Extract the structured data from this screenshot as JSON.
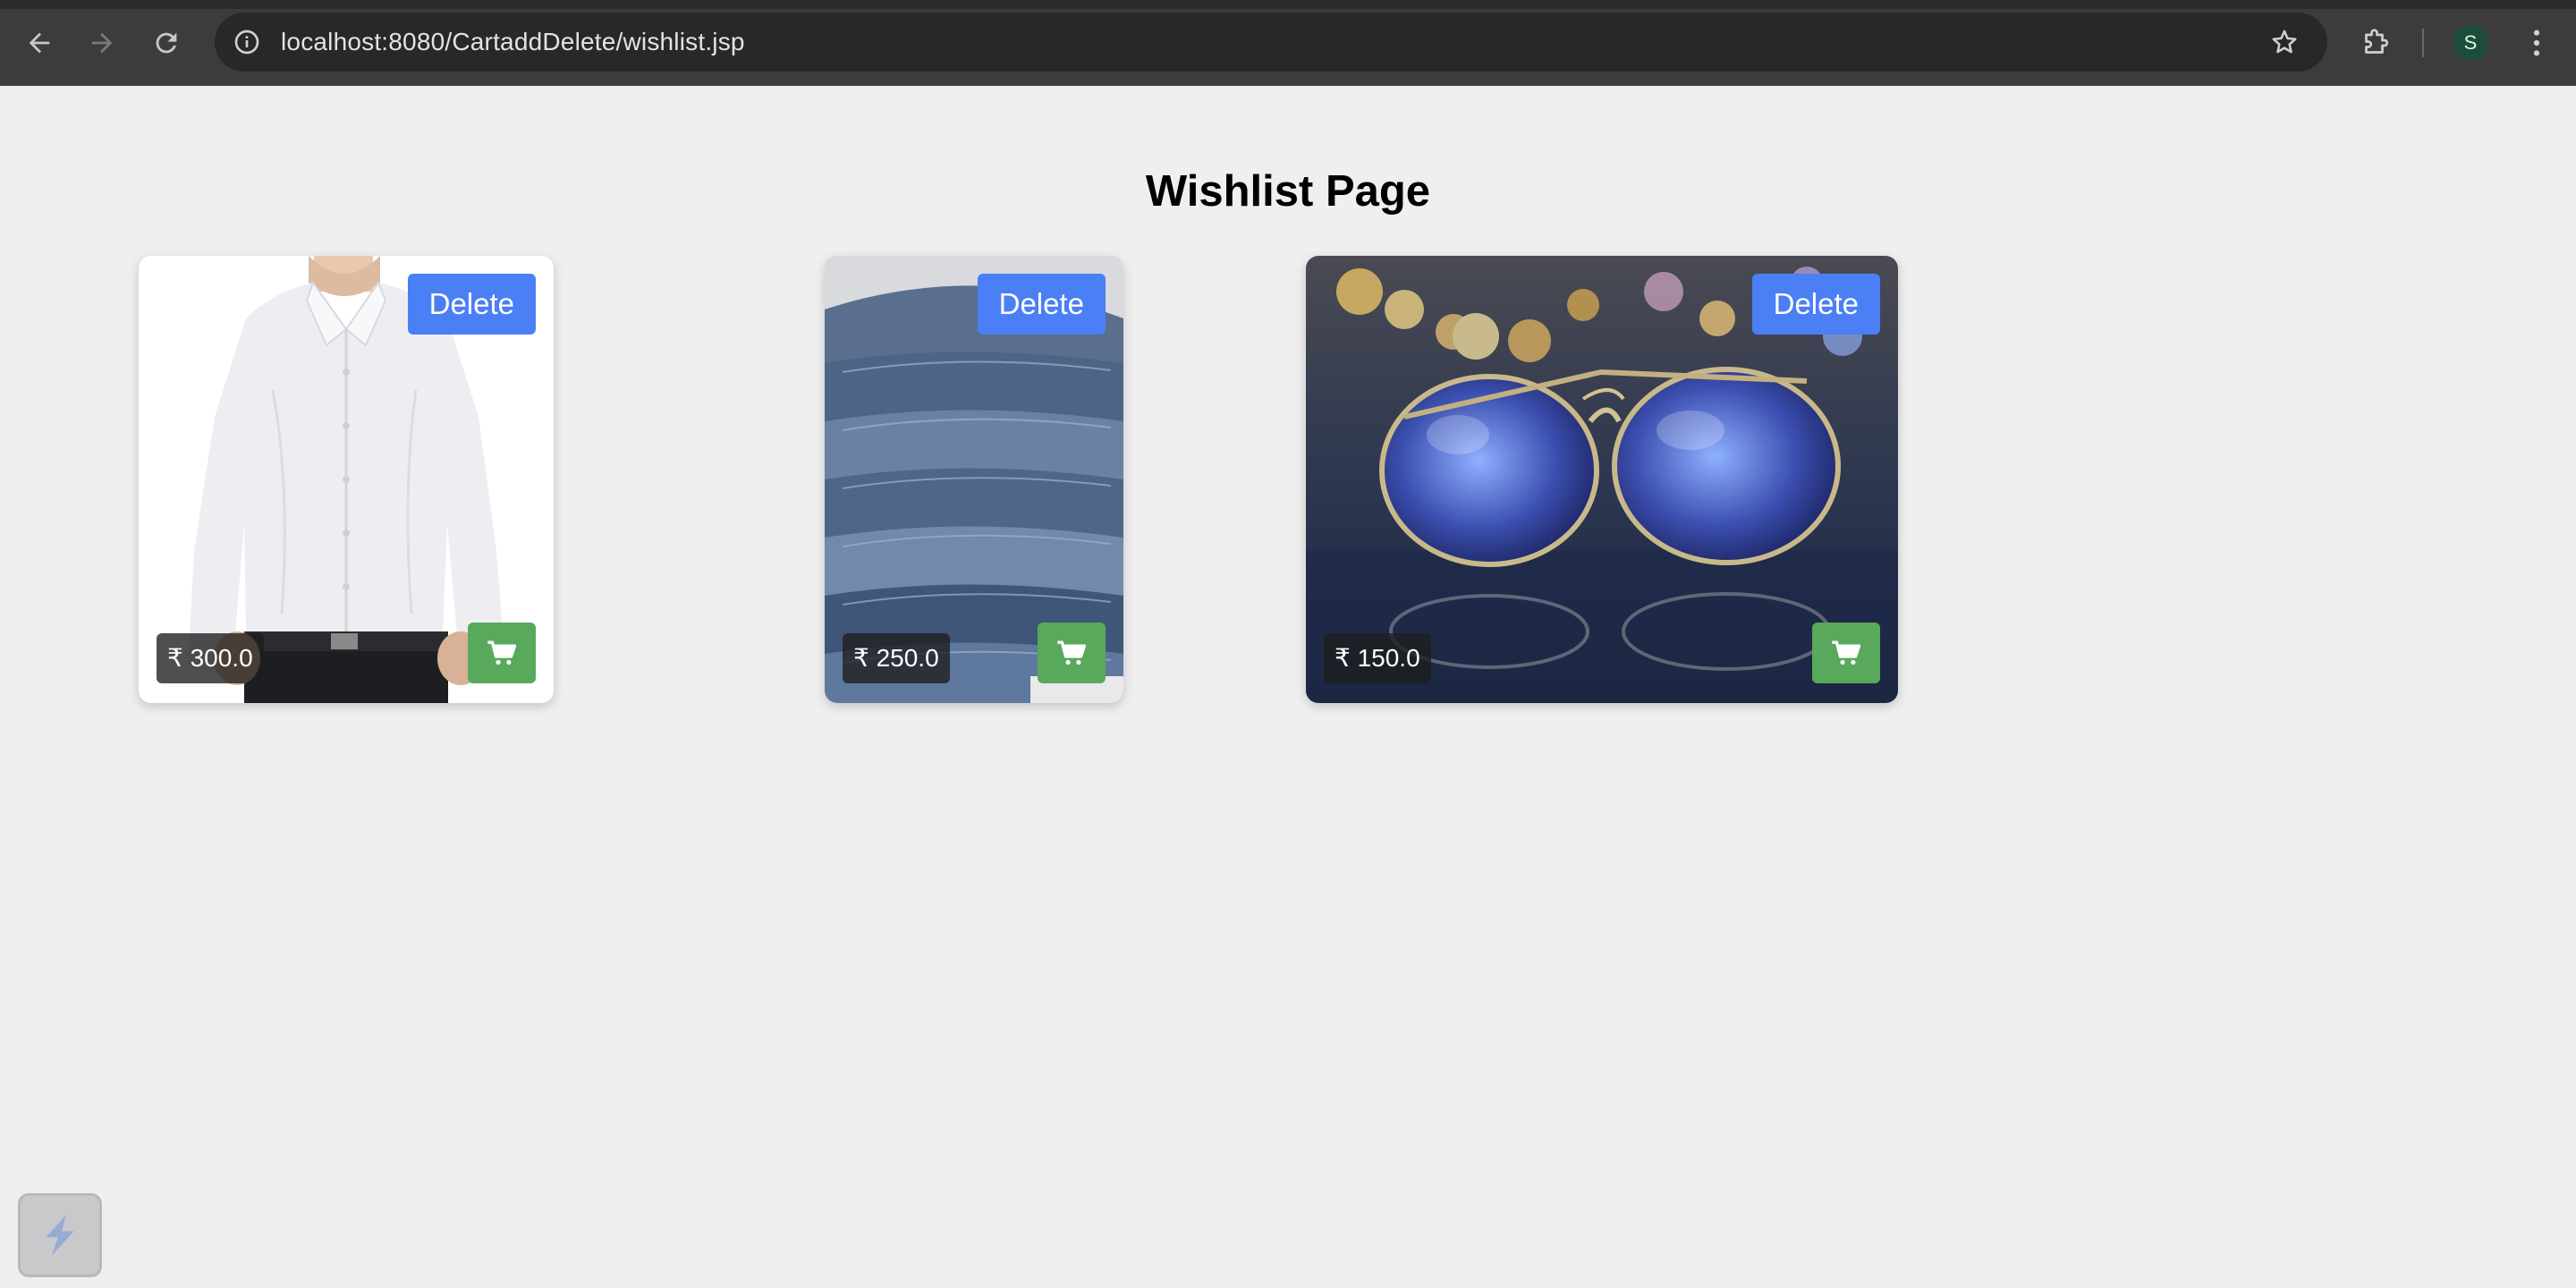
{
  "browser": {
    "url": "localhost:8080/CartaddDelete/wishlist.jsp",
    "profile_initial": "S",
    "icons": {
      "back": "arrow-left-icon",
      "forward": "arrow-right-icon",
      "reload": "reload-icon",
      "site_info": "info-icon",
      "bookmark": "star-icon",
      "extensions": "puzzle-icon",
      "menu": "kebab-menu-icon"
    }
  },
  "page": {
    "title": "Wishlist Page"
  },
  "wishlist": {
    "items": [
      {
        "image": "white-shirt",
        "price": "₹ 300.0",
        "delete_label": "Delete",
        "cart_icon": "cart-icon"
      },
      {
        "image": "stacked-jeans",
        "price": "₹ 250.0",
        "delete_label": "Delete",
        "cart_icon": "cart-icon"
      },
      {
        "image": "sunglasses",
        "price": "₹ 150.0",
        "delete_label": "Delete",
        "cart_icon": "cart-icon"
      }
    ]
  },
  "colors": {
    "delete_button": "#4a7ff5",
    "cart_button": "#58a95b",
    "page_background": "#efefef",
    "browser_toolbar": "#3c3c3c"
  }
}
